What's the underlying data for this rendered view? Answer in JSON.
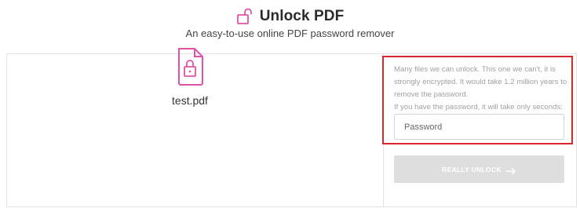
{
  "header": {
    "title": "Unlock PDF",
    "subtitle": "An easy-to-use online PDF password remover",
    "icon": "unlock-padlock-icon"
  },
  "file": {
    "name": "test.pdf",
    "icon": "locked-pdf-file-icon"
  },
  "unlock_panel": {
    "info_text": "Many files we can unlock. This one we can't, it is strongly encrypted. It would take 1.2 million years to remove the password.\nIf you have the password, it will take only seconds:",
    "password_placeholder": "Password",
    "password_value": "",
    "button_label": "REALLY UNLOCK",
    "button_icon": "arrow-right-icon"
  },
  "colors": {
    "brand_pink": "#e052a8",
    "highlight_red": "#d9262c",
    "button_disabled": "#dedede"
  }
}
